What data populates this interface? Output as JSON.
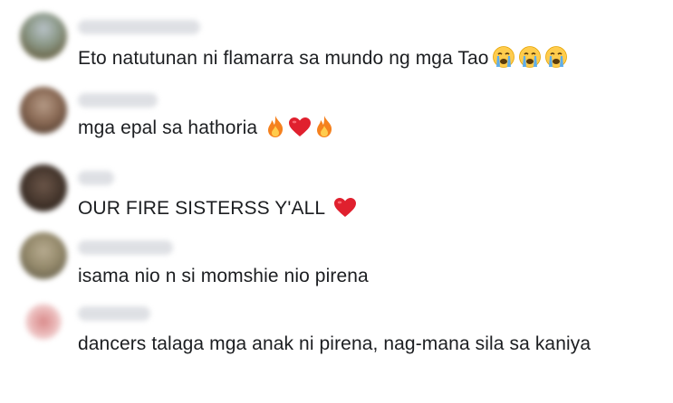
{
  "comments": [
    {
      "text": "Eto natutunan ni flamarra sa mundo ng mga Tao",
      "emojis": [
        "crying-face-icon",
        "crying-face-icon",
        "crying-face-icon"
      ],
      "avatar_color": "#8c8f7a"
    },
    {
      "text": "mga epal sa hathoria",
      "emojis": [
        "fire-icon",
        "red-heart-icon",
        "fire-icon"
      ],
      "avatar_color": "#7a5d4c"
    },
    {
      "text": "OUR FIRE SISTERSS Y'ALL",
      "emojis": [
        "red-heart-icon"
      ],
      "avatar_color": "#3f3026"
    },
    {
      "text": "isama nio n si momshie nio pirena",
      "emojis": [],
      "avatar_color": "#8d8167"
    },
    {
      "text": "dancers talaga mga anak ni pirena, nag-mana sila sa kaniya",
      "emojis": [],
      "avatar_color": "#e4b3b3"
    }
  ],
  "colors": {
    "text": "#1c1e21",
    "username_blur": "#d9dbe0",
    "heart": "#e0202e",
    "fire": "#f5811e"
  }
}
